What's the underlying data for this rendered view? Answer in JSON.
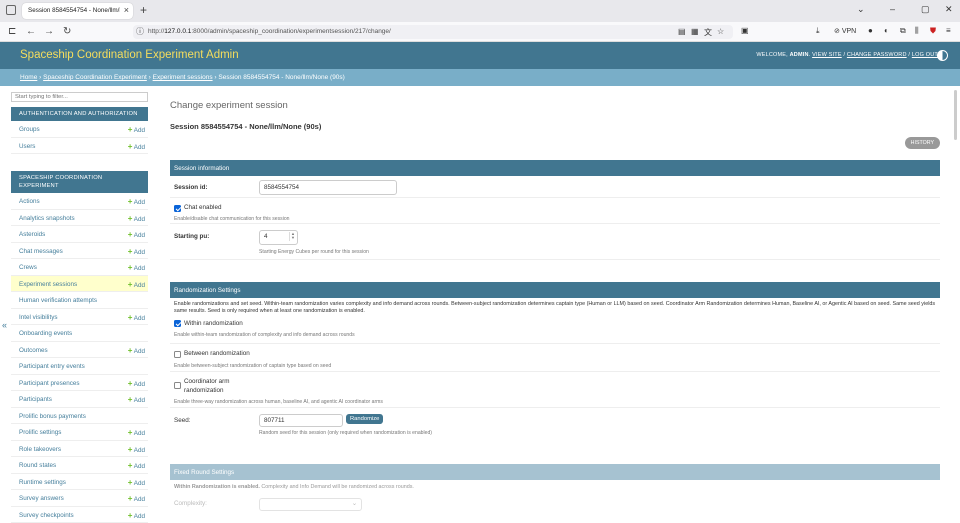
{
  "browser": {
    "tab_title": "Session 8584554754 - None/llm/No",
    "url_prefix": "http://",
    "url_host": "127.0.0.1",
    "url_rest": ":8000/admin/spaceship_coordination/experimentsession/217/change/",
    "vpn_label": "VPN"
  },
  "header": {
    "brand": "Spaceship Coordination Experiment Admin",
    "welcome": "WELCOME,",
    "user": "ADMIN",
    "view_site": "VIEW SITE",
    "change_password": "CHANGE PASSWORD",
    "logout": "LOG OUT"
  },
  "breadcrumbs": {
    "home": "Home",
    "app": "Spaceship Coordination Experiment",
    "model": "Experiment sessions",
    "current": "Session 8584554754 - None/llm/None (90s)"
  },
  "sidebar": {
    "filter_placeholder": "Start typing to filter...",
    "add_label": "Add",
    "auth_caption": "AUTHENTICATION AND AUTHORIZATION",
    "auth_items": [
      {
        "label": "Groups",
        "add": true
      },
      {
        "label": "Users",
        "add": true
      }
    ],
    "exp_caption": "SPACESHIP COORDINATION EXPERIMENT",
    "exp_items": [
      {
        "label": "Actions",
        "add": true
      },
      {
        "label": "Analytics snapshots",
        "add": true
      },
      {
        "label": "Asteroids",
        "add": true
      },
      {
        "label": "Chat messages",
        "add": true
      },
      {
        "label": "Crews",
        "add": true
      },
      {
        "label": "Experiment sessions",
        "add": true,
        "selected": true
      },
      {
        "label": "Human verification attempts",
        "add": false
      },
      {
        "label": "Intel visibilitys",
        "add": true
      },
      {
        "label": "Onboarding events",
        "add": false
      },
      {
        "label": "Outcomes",
        "add": true
      },
      {
        "label": "Participant entry events",
        "add": false
      },
      {
        "label": "Participant presences",
        "add": true
      },
      {
        "label": "Participants",
        "add": true
      },
      {
        "label": "Prolific bonus payments",
        "add": false
      },
      {
        "label": "Prolific settings",
        "add": true
      },
      {
        "label": "Role takeovers",
        "add": true
      },
      {
        "label": "Round states",
        "add": true
      },
      {
        "label": "Runtime settings",
        "add": true
      },
      {
        "label": "Survey answers",
        "add": true
      },
      {
        "label": "Survey checkpoints",
        "add": true
      }
    ]
  },
  "main": {
    "page_heading": "Change experiment session",
    "object_title": "Session 8584554754 - None/llm/None (90s)",
    "history_label": "HISTORY",
    "session_info": {
      "caption": "Session information",
      "session_id_label": "Session id:",
      "session_id_value": "8584554754",
      "chat_enabled_label": "Chat enabled",
      "chat_enabled_checked": true,
      "chat_help": "Enable/disable chat communication for this session",
      "starting_pu_label": "Starting pu:",
      "starting_pu_value": "4",
      "starting_pu_help": "Starting Energy Cubes per round for this session"
    },
    "randomization": {
      "caption": "Randomization Settings",
      "description": "Enable randomizations and set seed. Within-team randomization varies complexity and info demand across rounds. Between-subject randomization determines captain type (Human or LLM) based on seed. Coordinator Arm Randomization determines Human, Baseline AI, or Agentic AI based on seed. Same seed yields same results. Seed is only required when at least one randomization is enabled.",
      "within_label": "Within randomization",
      "within_checked": true,
      "within_help": "Enable within-team randomization of complexity and info demand across rounds",
      "between_label": "Between randomization",
      "between_checked": false,
      "between_help": "Enable between-subject randomization of captain type based on seed",
      "coord_label_1": "Coordinator arm",
      "coord_label_2": "randomization",
      "coord_checked": false,
      "coord_help": "Enable three-way randomization across human, baseline AI, and agentic AI coordinator arms",
      "seed_label": "Seed:",
      "seed_value": "807711",
      "randomize_button": "Randomize",
      "seed_help": "Random seed for this session (only required when randomization is enabled)"
    },
    "fixed_round": {
      "caption": "Fixed Round Settings",
      "note_bold": "Within Randomization is enabled.",
      "note_rest": " Complexity and Info Demand will be randomized across rounds.",
      "complexity_label": "Complexity:"
    }
  },
  "colors": {
    "header": "#417690",
    "breadcrumbs": "#79aec8",
    "brand": "#f5dd5d",
    "link": "#447e9b",
    "add_plus": "#70bf2b",
    "selected_row": "#ffffcc"
  }
}
